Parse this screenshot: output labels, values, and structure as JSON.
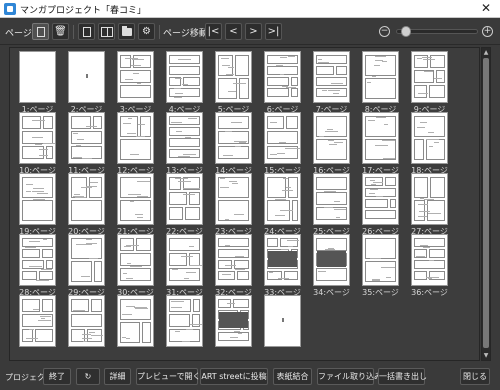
{
  "window": {
    "title": "マンガプロジェクト「春コミ」",
    "close_glyph": "✕"
  },
  "toolbar": {
    "page_label": "ページ:",
    "page_move_label": "ページ移動",
    "first_glyph": "|<",
    "prev_glyph": "<",
    "next_glyph": ">",
    "last_glyph": ">|",
    "zoom_out_glyph": "−",
    "zoom_in_glyph": "+",
    "zoom_level": 0.05
  },
  "pages": [
    {
      "label": "1:ページ"
    },
    {
      "label": "2:ページ"
    },
    {
      "label": "3:ページ"
    },
    {
      "label": "4:ページ"
    },
    {
      "label": "5:ページ"
    },
    {
      "label": "6:ページ"
    },
    {
      "label": "7:ページ"
    },
    {
      "label": "8:ページ"
    },
    {
      "label": "9:ページ"
    },
    {
      "label": "10:ページ"
    },
    {
      "label": "11:ページ"
    },
    {
      "label": "12:ページ"
    },
    {
      "label": "13:ページ"
    },
    {
      "label": "14:ページ"
    },
    {
      "label": "15:ページ"
    },
    {
      "label": "16:ページ"
    },
    {
      "label": "17:ページ"
    },
    {
      "label": "18:ページ"
    },
    {
      "label": "19:ページ"
    },
    {
      "label": "20:ページ"
    },
    {
      "label": "21:ページ"
    },
    {
      "label": "22:ページ"
    },
    {
      "label": "23:ページ"
    },
    {
      "label": "24:ページ"
    },
    {
      "label": "25:ページ"
    },
    {
      "label": "26:ページ"
    },
    {
      "label": "27:ページ"
    },
    {
      "label": "28:ページ"
    },
    {
      "label": "29:ページ"
    },
    {
      "label": "30:ページ"
    },
    {
      "label": "31:ページ"
    },
    {
      "label": "32:ページ"
    },
    {
      "label": "33:ページ"
    },
    {
      "label": "34:ページ"
    },
    {
      "label": "35:ページ"
    },
    {
      "label": "36:ページ"
    },
    {
      "label": ""
    },
    {
      "label": ""
    },
    {
      "label": ""
    },
    {
      "label": ""
    },
    {
      "label": ""
    },
    {
      "label": ""
    }
  ],
  "bottom": {
    "project_label": "プロジェクト:",
    "end_button": "終了",
    "refresh_glyph": "↻",
    "detail_button": "詳細",
    "preview_button": "プレビューで開く",
    "artstreet_button": "ART streetに投稿",
    "cover_button": "表紙結合",
    "import_button": "ファイル取り込み",
    "export_button": "一括書き出し",
    "close_button": "閉じる"
  }
}
